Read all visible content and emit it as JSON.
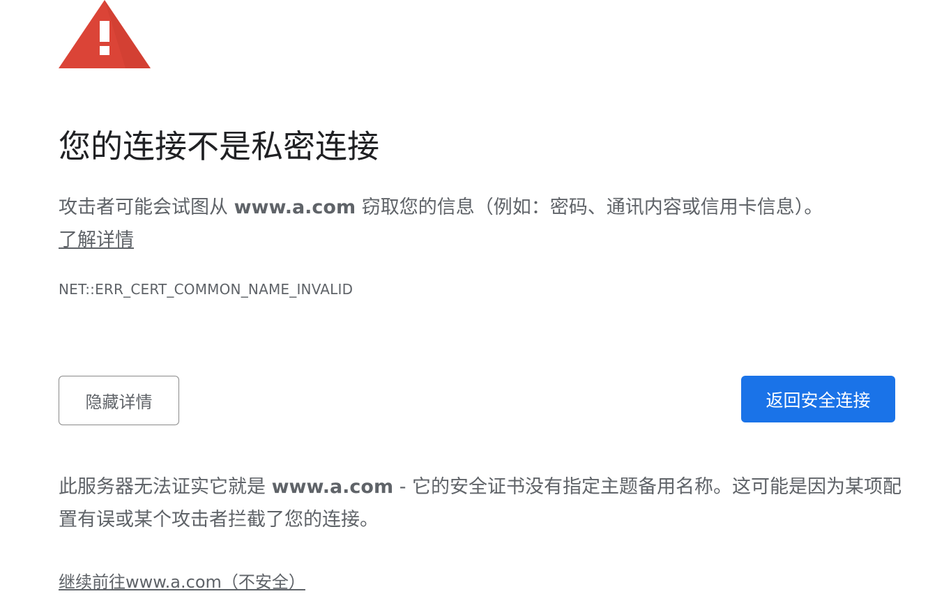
{
  "warning": {
    "icon": "warning-triangle-icon",
    "icon_color": "#db4437"
  },
  "title": "您的连接不是私密连接",
  "description": {
    "prefix": "攻击者可能会试图从 ",
    "host": "www.a.com",
    "suffix": " 窃取您的信息（例如：密码、通讯内容或信用卡信息）。",
    "learn_more": "了解详情"
  },
  "error_code": "NET::ERR_CERT_COMMON_NAME_INVALID",
  "buttons": {
    "hide_details": "隐藏详情",
    "back_to_safety": "返回安全连接",
    "primary_color": "#1a73e8"
  },
  "details": {
    "prefix": "此服务器无法证实它就是 ",
    "host": "www.a.com",
    "suffix": " - 它的安全证书没有指定主题备用名称。这可能是因为某项配置有误或某个攻击者拦截了您的连接。"
  },
  "proceed_link": "继续前往www.a.com（不安全）"
}
